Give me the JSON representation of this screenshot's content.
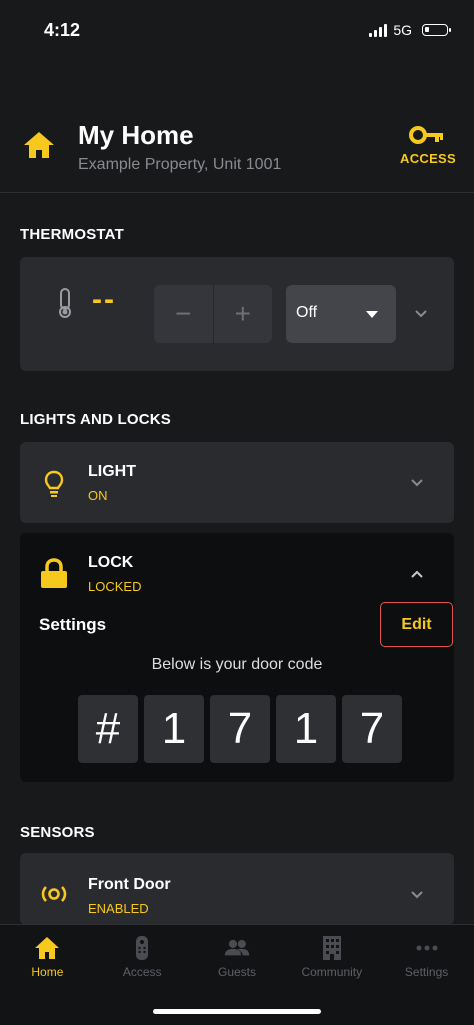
{
  "status": {
    "time": "4:12",
    "network": "5G"
  },
  "header": {
    "title": "My Home",
    "subtitle": "Example Property, Unit 1001",
    "access_label": "ACCESS"
  },
  "colors": {
    "accent": "#f7c91c",
    "background": "#18191b",
    "card": "#2a2b2f",
    "edit_border": "#e5544b"
  },
  "thermostat": {
    "section_title": "THERMOSTAT",
    "value": "--",
    "decrease_label": "−",
    "increase_label": "+",
    "mode": "Off"
  },
  "lights_locks": {
    "section_title": "LIGHTS AND LOCKS",
    "light": {
      "name": "LIGHT",
      "status": "ON",
      "icon": "lightbulb-icon"
    },
    "lock": {
      "name": "LOCK",
      "status": "LOCKED",
      "icon": "padlock-icon",
      "settings_label": "Settings",
      "edit_label": "Edit",
      "code_caption": "Below is your door code",
      "code": [
        "#",
        "1",
        "7",
        "1",
        "7"
      ]
    }
  },
  "sensors": {
    "section_title": "SENSORS",
    "items": [
      {
        "name": "Front Door",
        "status": "ENABLED",
        "icon": "sensor-icon"
      }
    ]
  },
  "tabs": [
    {
      "label": "Home",
      "icon": "home-icon",
      "active": true
    },
    {
      "label": "Access",
      "icon": "remote-icon",
      "active": false
    },
    {
      "label": "Guests",
      "icon": "people-icon",
      "active": false
    },
    {
      "label": "Community",
      "icon": "building-icon",
      "active": false
    },
    {
      "label": "Settings",
      "icon": "more-icon",
      "active": false
    }
  ]
}
